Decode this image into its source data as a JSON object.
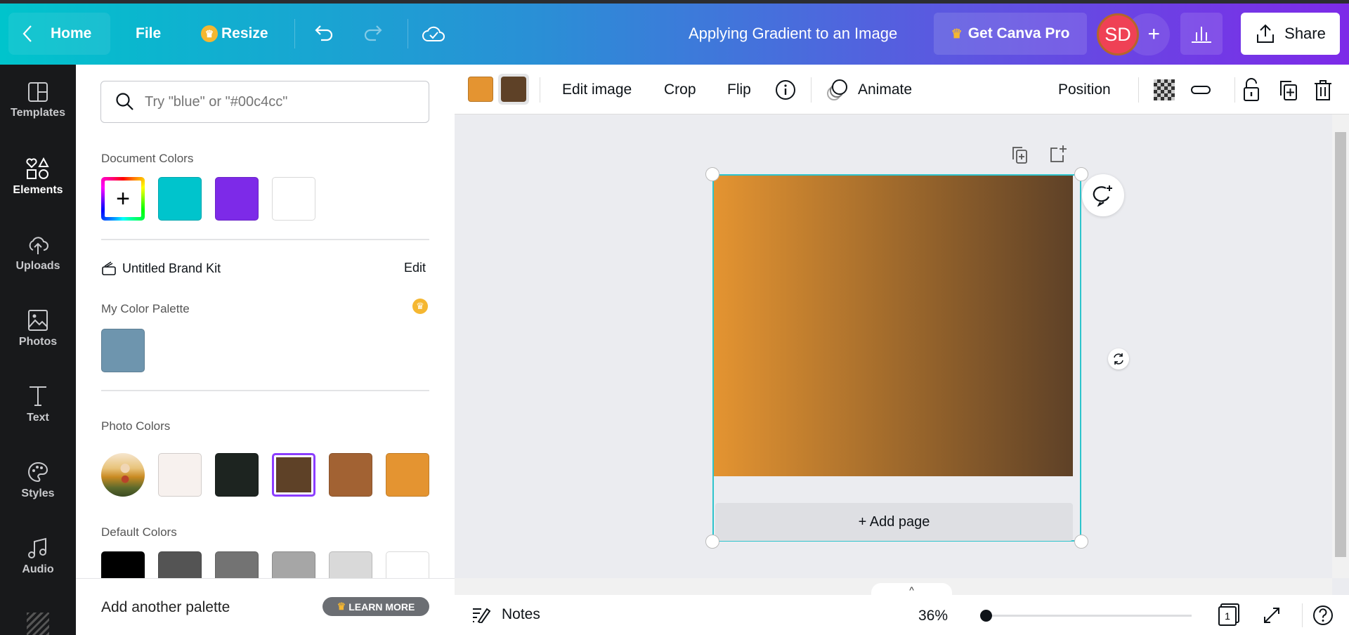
{
  "header": {
    "home_label": "Home",
    "file_label": "File",
    "resize_label": "Resize",
    "doc_title": "Applying Gradient to an Image",
    "pro_label": "Get Canva Pro",
    "avatar_initials": "SD",
    "share_label": "Share"
  },
  "rail": {
    "items": [
      {
        "label": "Templates",
        "icon": "templates-icon"
      },
      {
        "label": "Elements",
        "icon": "elements-icon",
        "active": true
      },
      {
        "label": "Uploads",
        "icon": "upload-icon"
      },
      {
        "label": "Photos",
        "icon": "photos-icon"
      },
      {
        "label": "Text",
        "icon": "text-icon"
      },
      {
        "label": "Styles",
        "icon": "styles-icon"
      },
      {
        "label": "Audio",
        "icon": "audio-icon"
      }
    ]
  },
  "panel": {
    "search_placeholder": "Try \"blue\" or \"#00c4cc\"",
    "document_colors_label": "Document Colors",
    "document_colors": [
      "#00c4cc",
      "#7d2ae8",
      "#ffffff"
    ],
    "brand_kit_label": "Untitled Brand Kit",
    "edit_label": "Edit",
    "palette_label": "My Color Palette",
    "palette_colors": [
      "#6e95ae"
    ],
    "photo_colors_label": "Photo Colors",
    "photo_colors": [
      "#f7f1ee",
      "#1d2420",
      "#5e4127",
      "#a26233",
      "#e49431"
    ],
    "selected_photo_color": "#5e4127",
    "default_colors_label": "Default Colors",
    "default_colors": [
      "#000000",
      "#545454",
      "#737373",
      "#a6a6a6",
      "#d9d9d9",
      "#ffffff"
    ],
    "add_palette_label": "Add another palette",
    "learn_more_label": "LEARN MORE"
  },
  "toolbar": {
    "gradient_colors": [
      "#e49431",
      "#5e4127"
    ],
    "edit_image_label": "Edit image",
    "crop_label": "Crop",
    "flip_label": "Flip",
    "animate_label": "Animate",
    "position_label": "Position"
  },
  "canvas": {
    "add_page_label": "+ Add page",
    "gradient": [
      "#e49431",
      "#5e4127"
    ],
    "selection_color": "#2ec4cc"
  },
  "bottom": {
    "notes_label": "Notes",
    "zoom_label": "36%",
    "zoom_percent": 36,
    "page_count": "1"
  }
}
